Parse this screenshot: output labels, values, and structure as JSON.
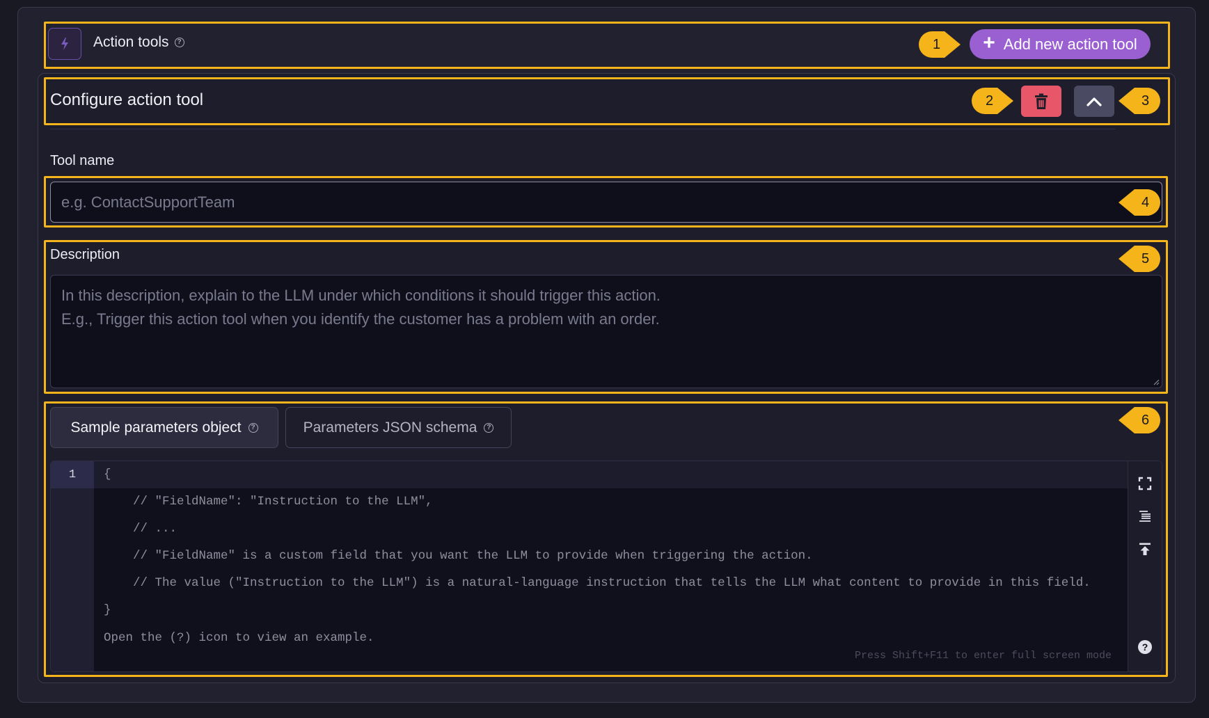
{
  "header": {
    "title": "Action tools",
    "add_button_label": "Add new action tool",
    "add_button_icon": "plus-icon"
  },
  "config": {
    "title": "Configure action tool",
    "delete_icon": "trash-icon",
    "collapse_icon": "chevron-up-icon"
  },
  "tool_name": {
    "label": "Tool name",
    "placeholder": "e.g. ContactSupportTeam",
    "value": ""
  },
  "description": {
    "label": "Description",
    "placeholder_lines": [
      "In this description, explain to the LLM under which conditions it should trigger this action.",
      "E.g., Trigger this action tool when you identify the customer has a problem with an order."
    ]
  },
  "parameters": {
    "tabs": [
      {
        "label": "Sample parameters object",
        "active": true
      },
      {
        "label": "Parameters JSON schema",
        "active": false
      }
    ],
    "editor": {
      "line_number": "1",
      "lines": [
        "{",
        "    // \"FieldName\": \"Instruction to the LLM\",",
        "    // ...",
        "    // \"FieldName\" is a custom field that you want the LLM to provide when triggering the action.",
        "    // The value (\"Instruction to the LLM\") is a natural-language instruction that tells the LLM what content to provide in this field.",
        "}",
        "Open the (?) icon to view an example."
      ],
      "hint": "Press Shift+F11 to enter full screen mode",
      "toolbar_icons": [
        "fullscreen-icon",
        "format-icon",
        "scroll-top-icon",
        "help-circle-icon"
      ]
    }
  },
  "markers": [
    "1",
    "2",
    "3",
    "4",
    "5",
    "6"
  ],
  "colors": {
    "accent_purple": "#9a5fd1",
    "danger_red": "#e8566a",
    "callout_yellow": "#f5b41a",
    "background": "#191924"
  }
}
